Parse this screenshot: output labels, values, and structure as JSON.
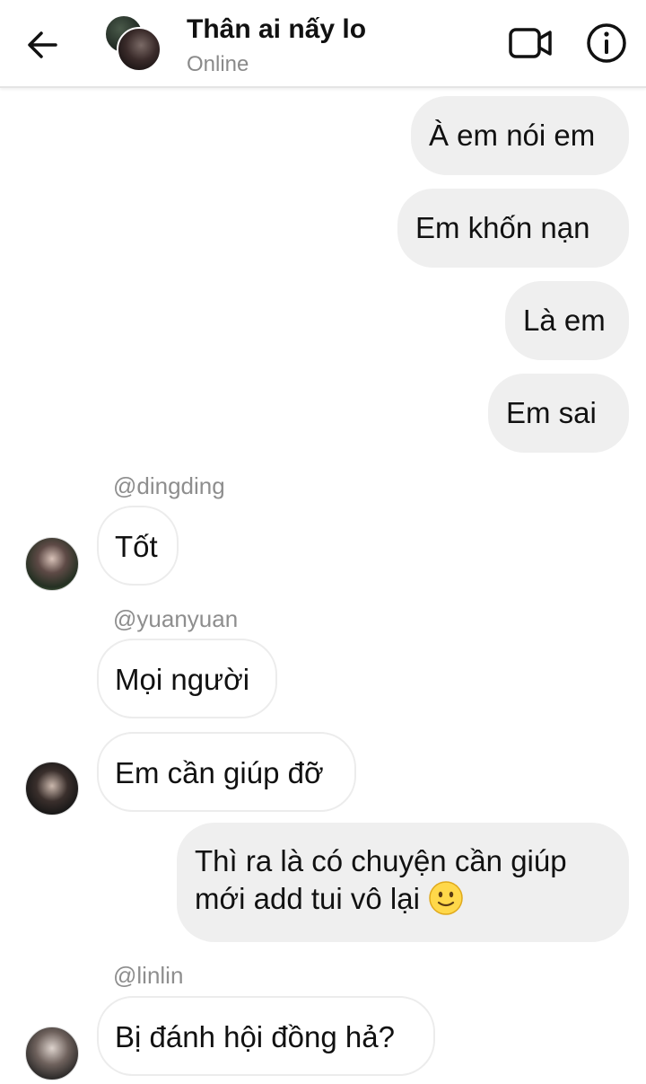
{
  "header": {
    "title": "Thân ai nấy lo",
    "status": "Online"
  },
  "messages": [
    {
      "side": "outgoing",
      "text": "À em nói em"
    },
    {
      "side": "outgoing",
      "text": "Em khốn nạn"
    },
    {
      "side": "outgoing",
      "text": "Là em"
    },
    {
      "side": "outgoing",
      "text": "Em sai"
    },
    {
      "side": "incoming",
      "sender": "@dingding",
      "text": "Tốt"
    },
    {
      "side": "incoming",
      "sender": "@yuanyuan",
      "text": "Mọi người"
    },
    {
      "side": "incoming",
      "sender": "@yuanyuan",
      "text": "Em cần giúp đỡ"
    },
    {
      "side": "outgoing",
      "lines": [
        "Thì ra là có chuyện cần giúp",
        "mới add tui vô lại"
      ],
      "emoji": "slightly-smiling-face"
    },
    {
      "side": "incoming",
      "sender": "@linlin",
      "text": "Bị đánh hội đồng hả?"
    }
  ],
  "icons": {
    "back": "arrow-left-icon",
    "video": "video-camera-icon",
    "info": "info-icon"
  }
}
